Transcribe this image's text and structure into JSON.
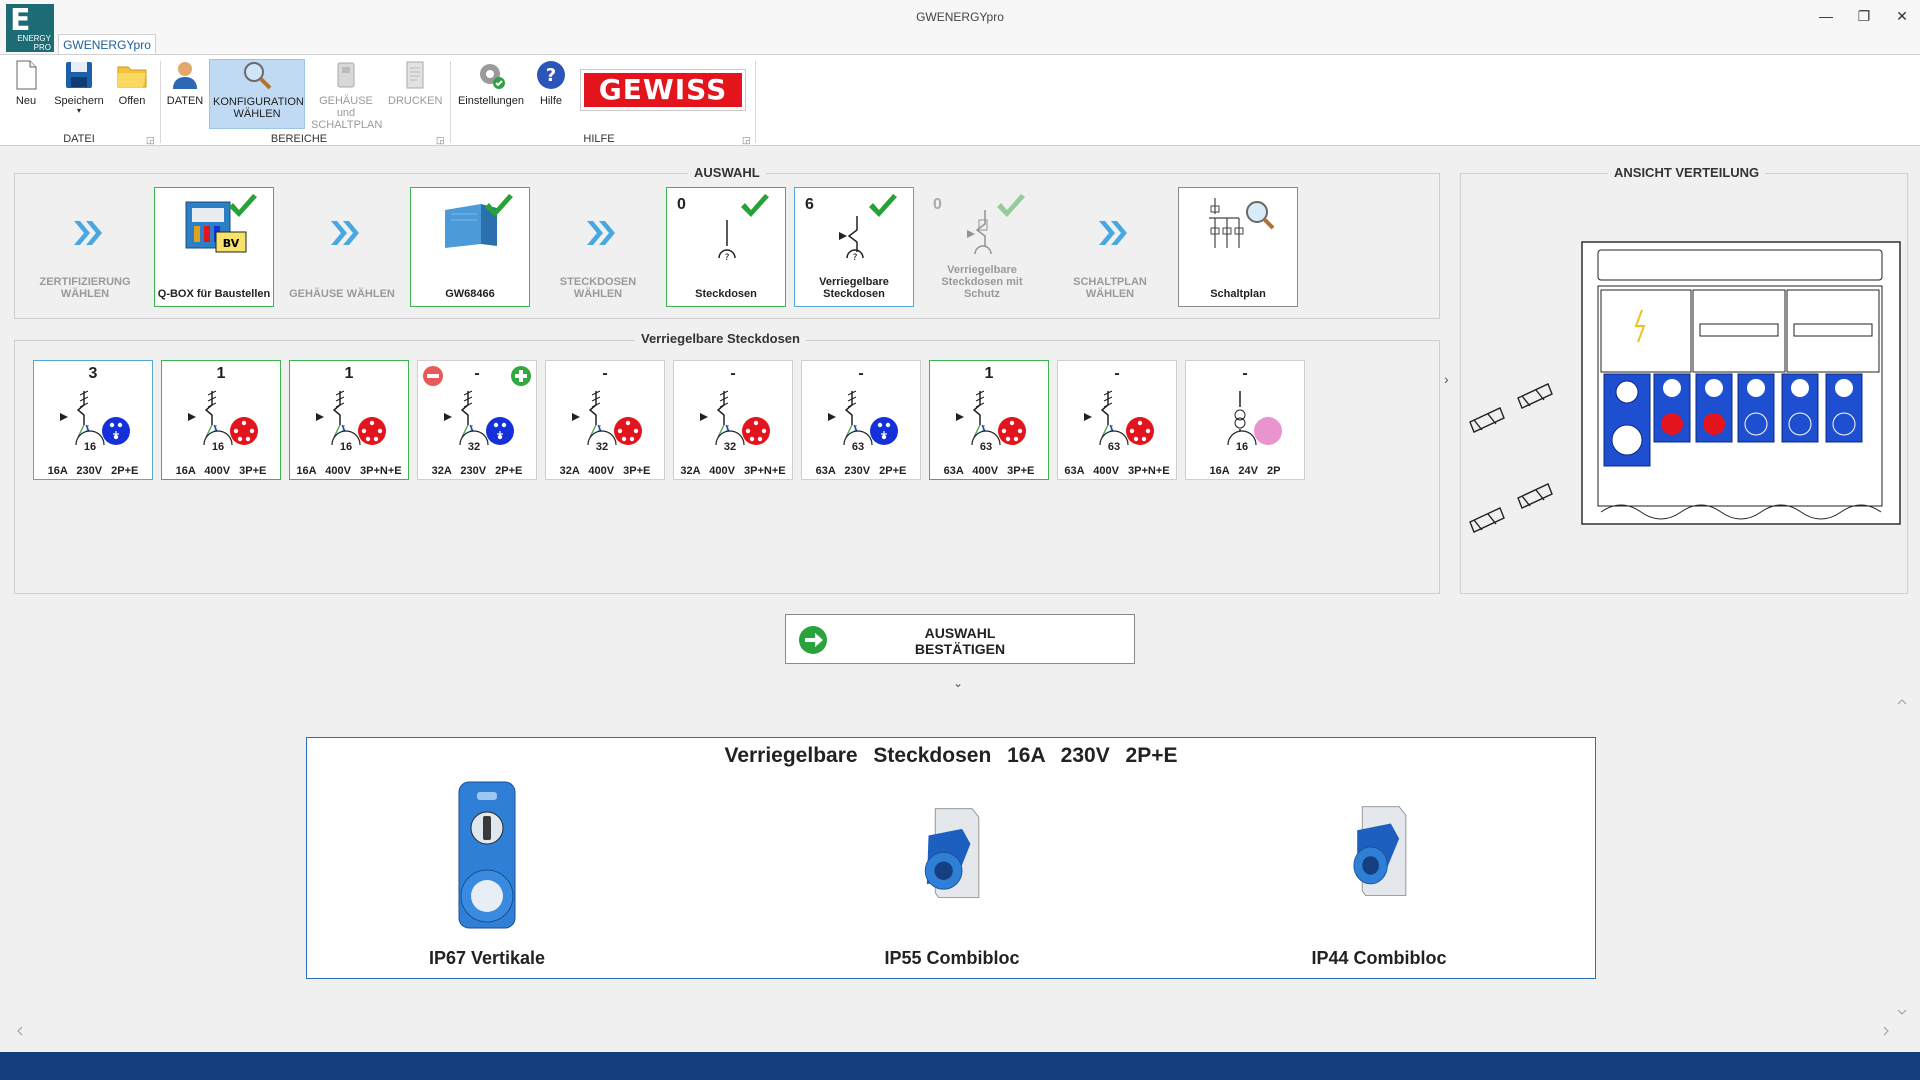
{
  "window": {
    "title": "GWENERGYpro",
    "tab": "GWENERGYpro",
    "logo_text": "ENERGY PRO",
    "logo_letter": "E"
  },
  "ribbon": {
    "buttons": {
      "neu": "Neu",
      "speichern": "Speichern",
      "offen": "Offen",
      "daten": "DATEN",
      "konfiguration": "KONFIGURATION WÄHLEN",
      "gehaeuse": "GEHÄUSE und SCHALTPLAN",
      "drucken": "DRUCKEN",
      "einstellungen": "Einstellungen",
      "hilfe": "Hilfe"
    },
    "groups": {
      "datei": "DATEI",
      "bereiche": "BEREICHE",
      "hilfe": "HILFE"
    },
    "brand": "GEWISS"
  },
  "auswahl": {
    "title": "AUSWAHL",
    "steps": [
      {
        "label": "ZERTIFIZIERUNG WÄHLEN"
      },
      {
        "label": "Q-BOX für Baustellen"
      },
      {
        "label": "GEHÄUSE WÄHLEN"
      },
      {
        "label": "GW68466"
      },
      {
        "label": "STECKDOSEN WÄHLEN"
      },
      {
        "label": "Steckdosen",
        "count": "0"
      },
      {
        "label": "Verriegelbare Steckdosen",
        "count": "6"
      },
      {
        "label": "Verriegelbare Steckdosen mit Schutz",
        "count": "0"
      },
      {
        "label": "SCHALTPLAN WÄHLEN"
      },
      {
        "label": "Schaltplan"
      }
    ]
  },
  "sockets_panel": {
    "title": "Verriegelbare Steckdosen",
    "items": [
      {
        "count": "3",
        "rating": "16",
        "spec": "16A 230V 2P+E",
        "color": "#1430d8"
      },
      {
        "count": "1",
        "rating": "16",
        "spec": "16A 400V 3P+E",
        "color": "#e4141c"
      },
      {
        "count": "1",
        "rating": "16",
        "spec": "16A 400V 3P+N+E",
        "color": "#e4141c"
      },
      {
        "count": "-",
        "rating": "32",
        "spec": "32A 230V 2P+E",
        "color": "#1430d8"
      },
      {
        "count": "-",
        "rating": "32",
        "spec": "32A 400V 3P+E",
        "color": "#e4141c"
      },
      {
        "count": "-",
        "rating": "32",
        "spec": "32A 400V 3P+N+E",
        "color": "#e4141c"
      },
      {
        "count": "-",
        "rating": "63",
        "spec": "63A 230V 2P+E",
        "color": "#1430d8"
      },
      {
        "count": "1",
        "rating": "63",
        "spec": "63A 400V 3P+E",
        "color": "#e4141c"
      },
      {
        "count": "-",
        "rating": "63",
        "spec": "63A 400V 3P+N+E",
        "color": "#e4141c"
      },
      {
        "count": "-",
        "rating": "16",
        "spec": "16A 24V 2P",
        "color": "#e993cf"
      }
    ]
  },
  "preview": {
    "title": "ANSICHT VERTEILUNG"
  },
  "confirm": {
    "label": "AUSWAHL BESTÄTIGEN"
  },
  "detail": {
    "title": "Verriegelbare Steckdosen 16A 230V 2P+E",
    "products": [
      {
        "label": "IP67 Vertikale"
      },
      {
        "label": "IP55 Combibloc"
      },
      {
        "label": "IP44 Combibloc"
      }
    ]
  },
  "colors": {
    "accent_green": "#3fb34f",
    "accent_blue": "#2d6fb5",
    "status_bar": "#153e7e",
    "brand_red": "#e4141c"
  }
}
